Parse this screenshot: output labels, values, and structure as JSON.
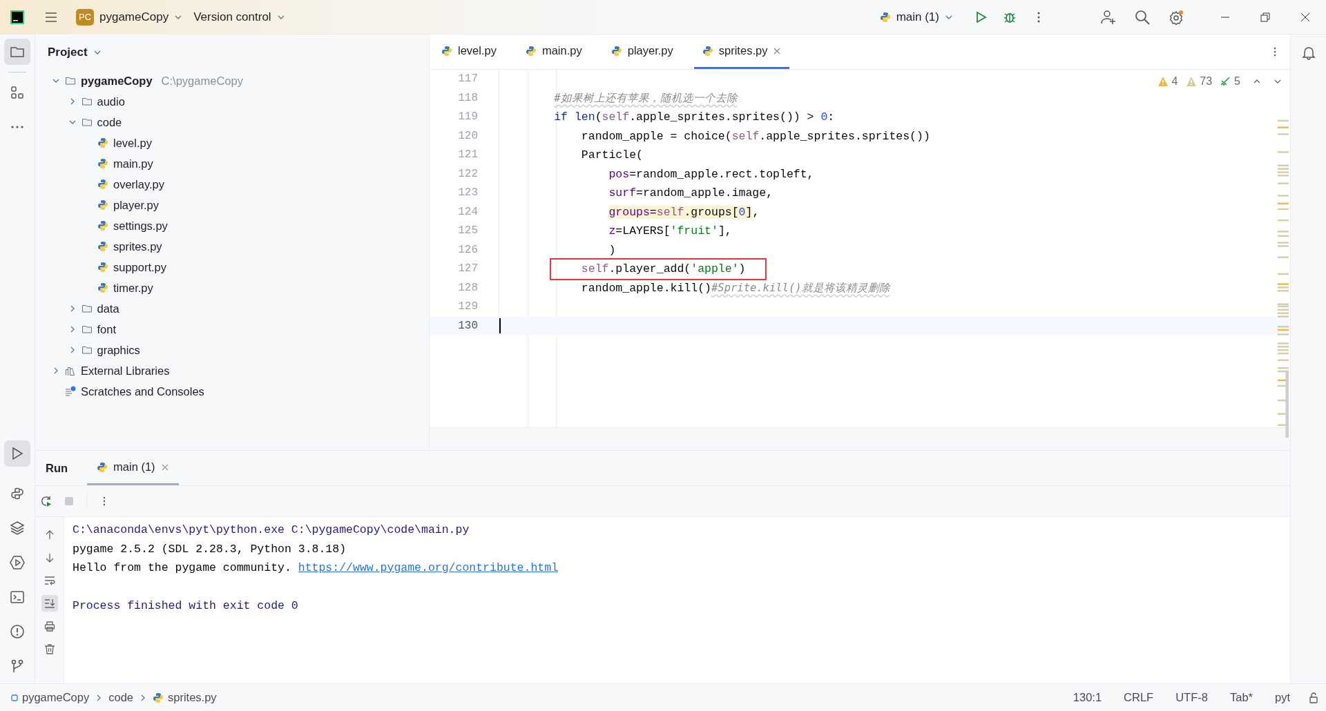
{
  "title_bar": {
    "project_badge": "PC",
    "project": "pygameCopy",
    "vcs": "Version control",
    "run_config": "main (1)"
  },
  "project_panel": {
    "title": "Project",
    "tree": [
      {
        "name": "pygameCopy",
        "path": "C:\\pygameCopy",
        "kind": "folder",
        "expanded": true,
        "children": [
          {
            "name": "audio",
            "kind": "folder",
            "expanded": false
          },
          {
            "name": "code",
            "kind": "folder",
            "expanded": true,
            "children": [
              {
                "name": "level.py",
                "kind": "python"
              },
              {
                "name": "main.py",
                "kind": "python"
              },
              {
                "name": "overlay.py",
                "kind": "python"
              },
              {
                "name": "player.py",
                "kind": "python"
              },
              {
                "name": "settings.py",
                "kind": "python"
              },
              {
                "name": "sprites.py",
                "kind": "python"
              },
              {
                "name": "support.py",
                "kind": "python"
              },
              {
                "name": "timer.py",
                "kind": "python"
              }
            ]
          },
          {
            "name": "data",
            "kind": "folder",
            "expanded": false
          },
          {
            "name": "font",
            "kind": "folder",
            "expanded": false
          },
          {
            "name": "graphics",
            "kind": "folder",
            "expanded": false
          }
        ]
      },
      {
        "name": "External Libraries",
        "kind": "libraries",
        "expanded": false
      },
      {
        "name": "Scratches and Consoles",
        "kind": "scratches"
      }
    ]
  },
  "editor": {
    "tabs": [
      {
        "label": "level.py",
        "selected": false
      },
      {
        "label": "main.py",
        "selected": false
      },
      {
        "label": "player.py",
        "selected": false
      },
      {
        "label": "sprites.py",
        "selected": true
      }
    ],
    "inspections": [
      {
        "kind": "warning",
        "count": "4"
      },
      {
        "kind": "weak_warning",
        "count": "73"
      },
      {
        "kind": "typo",
        "count": "5"
      }
    ],
    "lines": [
      {
        "number": "117",
        "boxed": false,
        "current": false
      },
      {
        "number": "118",
        "boxed": false,
        "current": false,
        "tokens": [
          {
            "kind": "comment",
            "text": "        #如果树上还有苹果，随机选一个去除"
          }
        ]
      },
      {
        "number": "119",
        "boxed": false,
        "current": false,
        "tokens": [
          {
            "kind": "keyword",
            "text": "        if len"
          },
          {
            "kind": "plain",
            "text": "("
          },
          {
            "kind": "self",
            "text": "self"
          },
          {
            "kind": "plain",
            "text": ".apple_sprites.sprites()) > "
          },
          {
            "kind": "number",
            "text": "0"
          },
          {
            "kind": "plain",
            "text": ":"
          }
        ]
      },
      {
        "number": "120",
        "boxed": false,
        "current": false,
        "tokens": [
          {
            "kind": "plain",
            "text": "            random_apple = choice("
          },
          {
            "kind": "self",
            "text": "self"
          },
          {
            "kind": "plain",
            "text": ".apple_sprites.sprites())"
          }
        ]
      },
      {
        "number": "121",
        "boxed": false,
        "current": false,
        "tokens": [
          {
            "kind": "plain",
            "text": "            Particle("
          }
        ]
      },
      {
        "number": "122",
        "boxed": false,
        "current": false,
        "tokens": [
          {
            "kind": "param",
            "text": "                pos"
          },
          {
            "kind": "plain",
            "text": "=random_apple.rect.topleft,"
          }
        ]
      },
      {
        "number": "123",
        "boxed": false,
        "current": false,
        "tokens": [
          {
            "kind": "param",
            "text": "                surf"
          },
          {
            "kind": "plain",
            "text": "=random_apple.image,"
          }
        ]
      },
      {
        "number": "124",
        "boxed": false,
        "current": false,
        "tokens": [
          {
            "kind": "param",
            "text": "                groups",
            "marked": true
          },
          {
            "kind": "plain",
            "text": "=",
            "marked": true
          },
          {
            "kind": "self",
            "text": "self",
            "marked": true
          },
          {
            "kind": "plain",
            "text": ".groups[",
            "marked": true
          },
          {
            "kind": "number",
            "text": "0",
            "marked": true
          },
          {
            "kind": "plain",
            "text": "]",
            "marked": true
          },
          {
            "kind": "plain",
            "text": ",",
            "marked": false
          }
        ]
      },
      {
        "number": "125",
        "boxed": false,
        "current": false,
        "tokens": [
          {
            "kind": "param",
            "text": "                z"
          },
          {
            "kind": "plain",
            "text": "=LAYERS["
          },
          {
            "kind": "string",
            "text": "'fruit'"
          },
          {
            "kind": "plain",
            "text": "],"
          }
        ]
      },
      {
        "number": "126",
        "boxed": false,
        "current": false,
        "tokens": [
          {
            "kind": "plain",
            "text": "                )"
          }
        ]
      },
      {
        "number": "127",
        "boxed": true,
        "current": false,
        "tokens": [
          {
            "kind": "self",
            "text": "            self"
          },
          {
            "kind": "plain",
            "text": ".player_add("
          },
          {
            "kind": "string",
            "text": "'apple'"
          },
          {
            "kind": "plain",
            "text": ")"
          }
        ]
      },
      {
        "number": "128",
        "boxed": false,
        "current": false,
        "tokens": [
          {
            "kind": "plain",
            "text": "            random_apple.kill()"
          },
          {
            "kind": "comment",
            "text": "#Sprite.kill()就是将该精灵删除"
          }
        ]
      },
      {
        "number": "129",
        "boxed": false,
        "current": false
      },
      {
        "number": "130",
        "boxed": false,
        "current": true
      }
    ]
  },
  "run_panel": {
    "title": "Run",
    "tabs": [
      {
        "label": "main (1)",
        "selected": true
      }
    ],
    "console": [
      {
        "kind": "system",
        "blank_line_before": false,
        "parts": [
          {
            "text": "C:\\anaconda\\envs\\pyt\\python.exe C:\\pygameCopy\\code\\main.py",
            "link": false
          }
        ]
      },
      {
        "kind": "output",
        "blank_line_before": false,
        "parts": [
          {
            "text": "pygame 2.5.2 (SDL 2.28.3, Python 3.8.18)",
            "link": false
          }
        ]
      },
      {
        "kind": "output",
        "blank_line_before": false,
        "parts": [
          {
            "text": "Hello from the pygame community. ",
            "link": false
          },
          {
            "text": "https://www.pygame.org/contribute.html",
            "link": true
          }
        ]
      },
      {
        "kind": "system",
        "blank_line_before": true,
        "parts": [
          {
            "text": "Process finished with exit code 0",
            "link": false
          }
        ]
      }
    ]
  },
  "status_bar": {
    "breadcrumbs": [
      {
        "text": "pygameCopy"
      },
      {
        "text": "code"
      },
      {
        "text": "sprites.py"
      }
    ],
    "items": [
      "130:1",
      "CRLF",
      "UTF-8",
      "Tab*",
      "pyt"
    ]
  }
}
